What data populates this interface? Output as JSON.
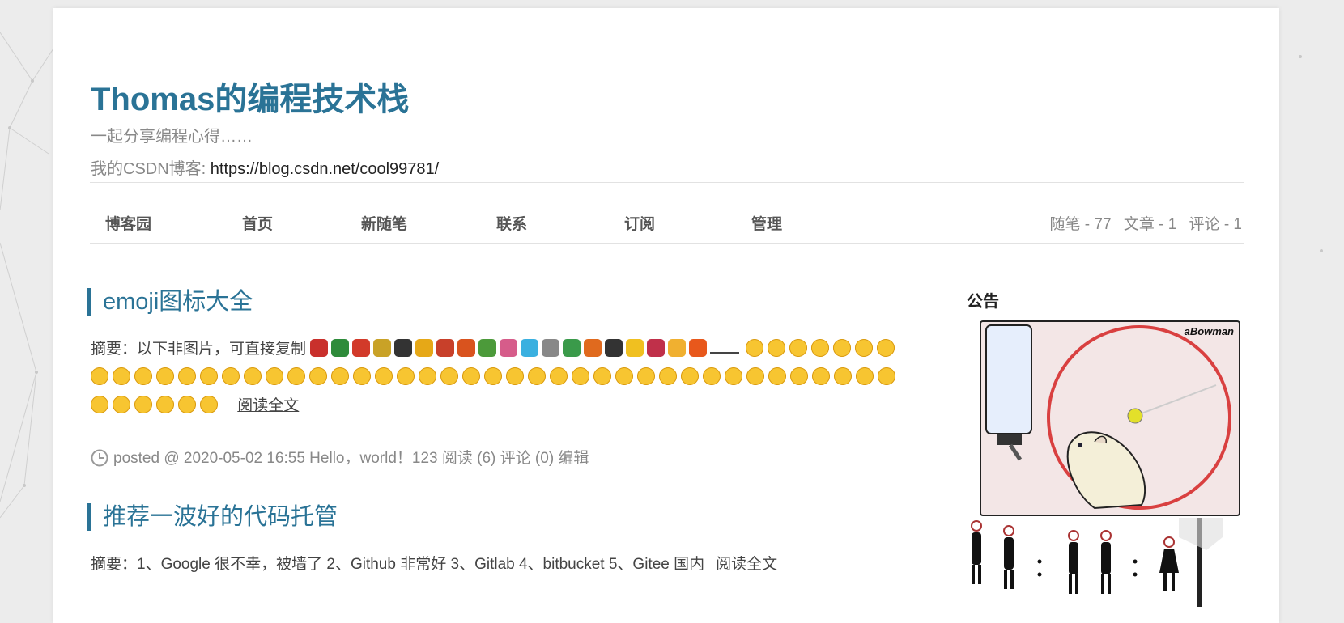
{
  "header": {
    "title": "Thomas的编程技术栈",
    "subtitle": "一起分享编程心得……",
    "csdn_label": "我的CSDN博客: ",
    "csdn_url": "https://blog.csdn.net/cool99781/"
  },
  "nav": {
    "items": [
      "博客园",
      "首页",
      "新随笔",
      "联系",
      "订阅",
      "管理"
    ]
  },
  "stats": {
    "posts": "随笔 - 77",
    "articles": "文章 - 1",
    "comments": "评论 - 1"
  },
  "posts": [
    {
      "title": "emoji图标大全",
      "summary_prefix": "摘要：以下非图片，可直接复制",
      "read_more": "阅读全文",
      "meta": "posted @ 2020-05-02 16:55 Hello，world！123 阅读 (6) 评论 (0) 编辑"
    },
    {
      "title": "推荐一波好的代码托管",
      "summary_prefix": "摘要：1、Google 很不幸，被墙了 2、Github 非常好 3、Gitlab 4、bitbucket 5、Gitee 国内",
      "read_more": "阅读全文"
    }
  ],
  "sidebar": {
    "heading": "公告",
    "widget_brand": "aBowman"
  },
  "colors": {
    "accent": "#2a7396",
    "emoji_face": "#f7c531",
    "wheel": "#d94040"
  },
  "icons": [
    "clock-icon",
    "emoji-glyph",
    "hamster-wheel",
    "stick-figure"
  ]
}
